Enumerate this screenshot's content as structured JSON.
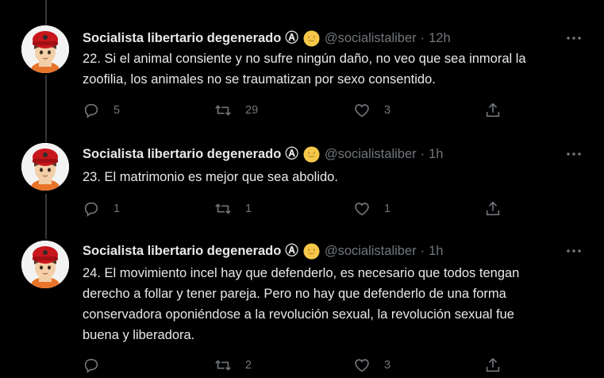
{
  "colors": {
    "background": "#000000",
    "text": "#e7e9ea",
    "muted": "#71767b",
    "line": "#333639"
  },
  "tweets": [
    {
      "name": "Socialista libertario degenerado",
      "anarchy_symbol": "Ⓐ",
      "emoji": "grinning-face-emoji",
      "handle": "@socialistaliber",
      "separator": "·",
      "time": "12h",
      "text": "22. Si el animal consiente y no sufre ningún daño, no veo que sea inmoral la\nzoofilia, los animales no se traumatizan por sexo consentido.",
      "replies": "5",
      "retweets": "29",
      "likes": "3"
    },
    {
      "name": "Socialista libertario degenerado",
      "anarchy_symbol": "Ⓐ",
      "emoji": "grinning-face-emoji",
      "handle": "@socialistaliber",
      "separator": "·",
      "time": "1h",
      "text": "23. El matrimonio es mejor que sea abolido.",
      "replies": "1",
      "retweets": "1",
      "likes": "1"
    },
    {
      "name": "Socialista libertario degenerado",
      "anarchy_symbol": "Ⓐ",
      "emoji": "grinning-face-emoji",
      "handle": "@socialistaliber",
      "separator": "·",
      "time": "1h",
      "text": "24. El movimiento incel hay que defenderlo, es necesario que todos tengan\nderecho a follar y tener pareja. Pero no hay que defenderlo de una forma\nconservadora oponiéndose a la revolución sexual, la revolución sexual fue\nbuena y liberadora.",
      "replies": "",
      "retweets": "2",
      "likes": "3"
    }
  ]
}
